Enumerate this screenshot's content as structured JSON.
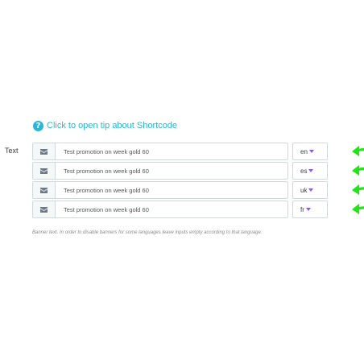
{
  "tip": {
    "icon": "question-circle-icon",
    "label": "Click to open tip about Shortcode",
    "color": "#25b9d7"
  },
  "field": {
    "label": "Text"
  },
  "rows": [
    {
      "icon": "envelope-icon",
      "value": "Test promotion on week gold 60",
      "lang": "en"
    },
    {
      "icon": "envelope-icon",
      "value": "Test promotion on week gold 60",
      "lang": "es"
    },
    {
      "icon": "envelope-icon",
      "value": "Test promotion on week gold 60",
      "lang": "uk"
    },
    {
      "icon": "envelope-icon",
      "value": "Test promotion on week gold 60",
      "lang": "fr"
    }
  ],
  "help_text": "Banner text. In order to disable banners for some languages leave inputs empty according to that language.",
  "colors": {
    "accent": "#25b9d7",
    "caret": "#8c5bd6",
    "arrow": "#22e614",
    "border": "#cfd8dc"
  }
}
